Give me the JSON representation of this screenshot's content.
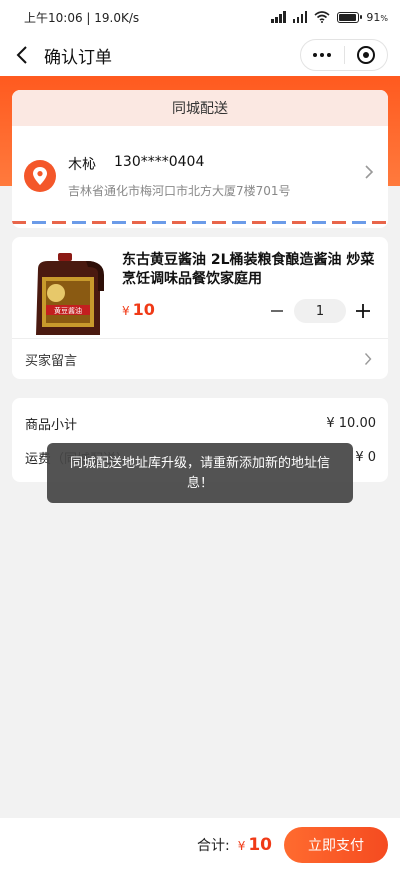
{
  "status_bar": {
    "time_speed": "上午10:06 | 19.0K/s",
    "battery_pct": "91"
  },
  "nav": {
    "title": "确认订单"
  },
  "delivery": {
    "mode": "同城配送"
  },
  "address": {
    "name": "木杺",
    "phone": "130****0404",
    "detail": "吉林省通化市梅河口市北方大厦7楼701号"
  },
  "product": {
    "title": "东古黄豆酱油 2L桶装粮食酿造酱油 炒菜烹饪调味品餐饮家庭用",
    "label_text": "黄豆酱油",
    "currency": "¥",
    "price": "10",
    "quantity": "1",
    "remark_label": "买家留言"
  },
  "summary": {
    "subtotal_label": "商品小计",
    "subtotal_value": "¥ 10.00",
    "shipping_label": "运费（同城配送）",
    "shipping_value": "¥ 0"
  },
  "toast": {
    "message": "同城配送地址库升级，请重新添加新的地址信息！"
  },
  "bottom": {
    "total_label": "合计:",
    "currency": "¥",
    "total_value": "10",
    "pay_label": "立即支付"
  },
  "colors": {
    "accent": "#f4572a",
    "price": "#f03a17"
  }
}
